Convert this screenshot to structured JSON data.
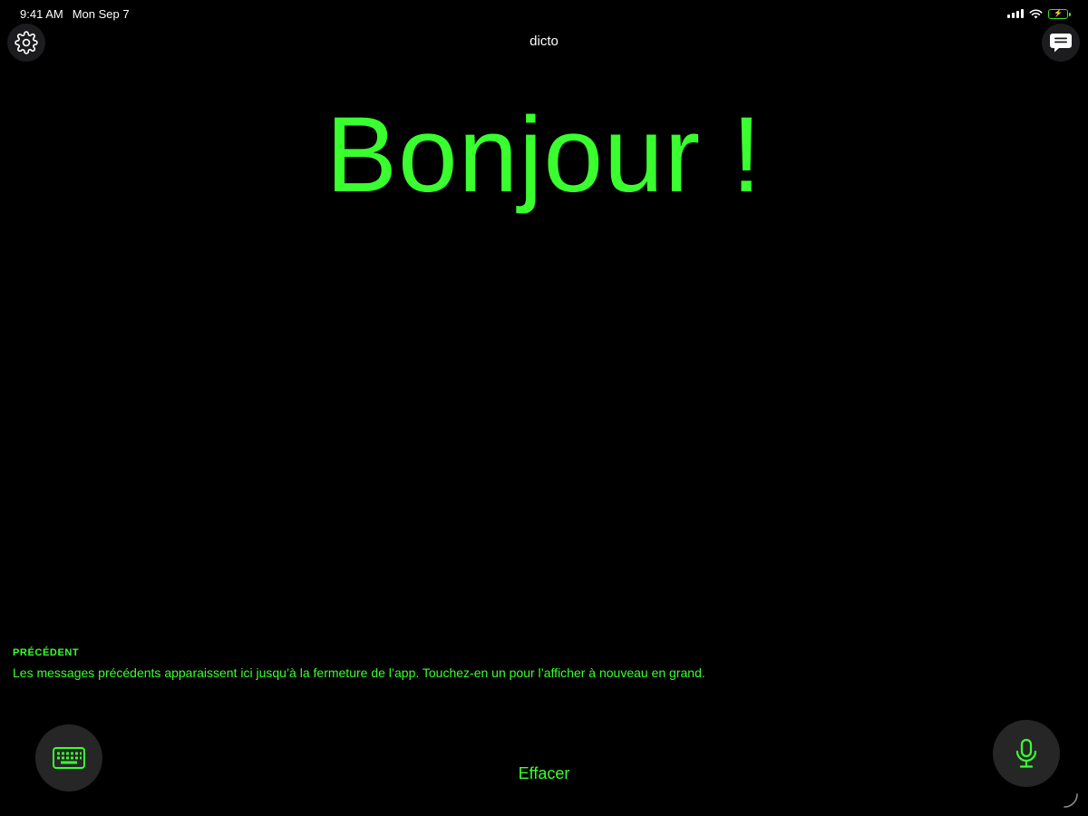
{
  "status_bar": {
    "time": "9:41 AM",
    "date": "Mon Sep 7",
    "icons": [
      "cellular-signal-icon",
      "wifi-icon",
      "battery-charging-icon"
    ],
    "battery_color": "#3ddc2b"
  },
  "header": {
    "title": "dicto",
    "left_button_icon": "gear-icon",
    "right_button_icon": "message-bubble-icon"
  },
  "main": {
    "message": "Bonjour !",
    "message_color": "#39ff2f"
  },
  "previous": {
    "heading": "PRÉCÉDENT",
    "hint": "Les messages précédents apparaissent ici jusqu’à la fermeture de l’app. Touchez-en un pour l’afficher à nouveau en grand."
  },
  "controls": {
    "keyboard_icon": "keyboard-icon",
    "clear_label": "Effacer",
    "mic_icon": "microphone-icon"
  },
  "colors": {
    "background": "#000000",
    "accent": "#39ff2f",
    "button_background": "#262626"
  }
}
